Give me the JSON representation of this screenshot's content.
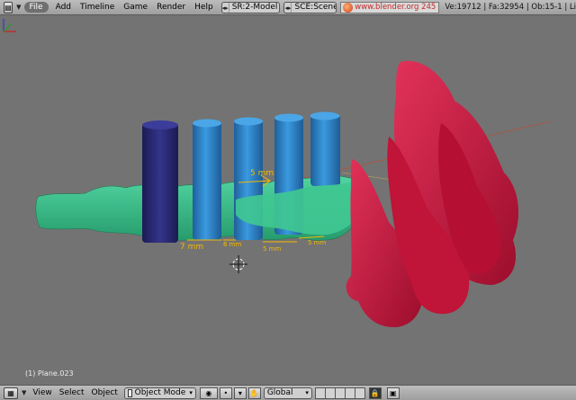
{
  "header": {
    "window_icon": "window-type-icon",
    "menu": [
      "File",
      "Add",
      "Timeline",
      "Game",
      "Render",
      "Help"
    ],
    "screen": "SR:2-Model",
    "scene": "SCE:Scene",
    "link": "www.blender.org 245",
    "stats": "Ve:19712 | Fa:32954 | Ob:15-1 | Li"
  },
  "viewport": {
    "object_label": "(1) Plane.023",
    "measurements": [
      "5 mm",
      "7 mm",
      "6 mm",
      "5 mm",
      "5 mm"
    ],
    "colors": {
      "background": "#737373",
      "soft_tissue": "#3fbf8c",
      "implant": "#2f86c8",
      "implant_dark": "#2a2a7a",
      "structure": "#c8143c",
      "dimension": "#f5b800"
    }
  },
  "footer": {
    "menu": [
      "View",
      "Select",
      "Object"
    ],
    "mode": "Object Mode",
    "orientation": "Global"
  }
}
